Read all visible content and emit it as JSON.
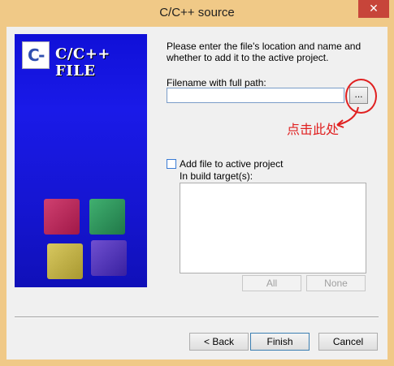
{
  "window": {
    "title": "C/C++ source",
    "close_glyph": "✕"
  },
  "banner": {
    "logo_text": "C-",
    "title": "C/C++ FILE"
  },
  "form": {
    "description": "Please enter the file's location and name and whether to add it to the active project.",
    "filename_label": "Filename with full path:",
    "filename_value": "",
    "browse_label": "...",
    "add_to_project_label": "Add file to active project",
    "add_to_project_checked": false,
    "build_targets_label": "In build target(s):",
    "build_targets": [],
    "all_label": "All",
    "none_label": "None"
  },
  "annotation": {
    "text": "点击此处",
    "color": "#e02020"
  },
  "footer": {
    "back_label": "< Back",
    "finish_label": "Finish",
    "cancel_label": "Cancel"
  },
  "colors": {
    "frame": "#f0c987",
    "close": "#c7453a",
    "banner": "#1414d8"
  }
}
